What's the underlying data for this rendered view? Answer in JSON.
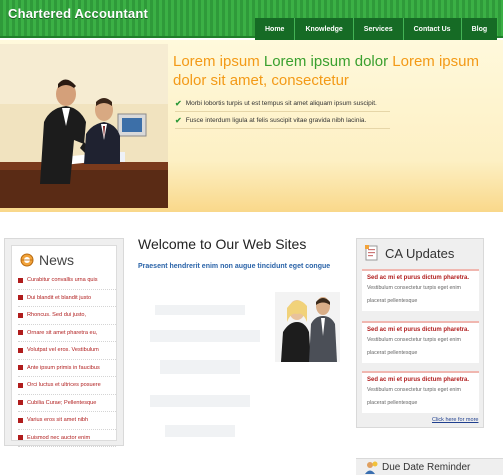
{
  "header": {
    "logo_text": "Chartered Accountant",
    "nav": [
      "Home",
      "Knowledge",
      "Services",
      "Contact Us",
      "Blog"
    ]
  },
  "hero": {
    "title_part1": "Lorem ipsum",
    "title_part2": "Lorem ipsum dolor",
    "title_part3": "Lorem ipsum",
    "title_part4": "dolor sit amet, consectetur",
    "bullets": [
      "Morbi lobortis turpis ut est tempus sit amet aliquam ipsum suscipit.",
      "Fusce interdum ligula at felis suscipit vitae gravida nibh lacinia."
    ]
  },
  "news": {
    "title": "News",
    "items": [
      "Curabitur convallis urna quis",
      "Dui blandit et blandit justo",
      "Rhoncus. Sed dui justo,",
      "Ornare sit amet pharetra eu,",
      "Volutpat vel eros. Vestibulum",
      "Ante ipsum primis in faucibus",
      "Orci luctus et ultrices posuere",
      "Cubilia Curae; Pellentesque",
      "Varius eros sit amet nibh",
      "Euismod nec auctor enim"
    ]
  },
  "main": {
    "welcome": "Welcome to Our Web Sites",
    "subtitle": "Praesent hendrerit enim non augue tincidunt eget congue"
  },
  "ca_updates": {
    "title": "CA Updates",
    "cards": [
      {
        "heading": "Sed ac mi et purus dictum pharetra.",
        "line1": "Vestibulum consectetur turpis eget enim",
        "line2": "placerat pellentesque"
      },
      {
        "heading": "Sed ac mi et purus dictum pharetra.",
        "line1": "Vestibulum consectetur turpis eget enim",
        "line2": "placerat pellentesque"
      },
      {
        "heading": "Sed ac mi et purus dictum pharetra.",
        "line1": "Vestibulum consectetur turpis eget enim",
        "line2": "placerat pellentesque"
      }
    ],
    "more_link": "Click here for more"
  },
  "due_date": {
    "title": "Due Date Reminder"
  },
  "colors": {
    "header_green": "#2f9a3a",
    "nav_dark_green": "#166b25",
    "hero_orange": "#f39a17",
    "hero_green": "#3aa02f",
    "news_red": "#b01c1c",
    "link_blue": "#2a63a8"
  }
}
